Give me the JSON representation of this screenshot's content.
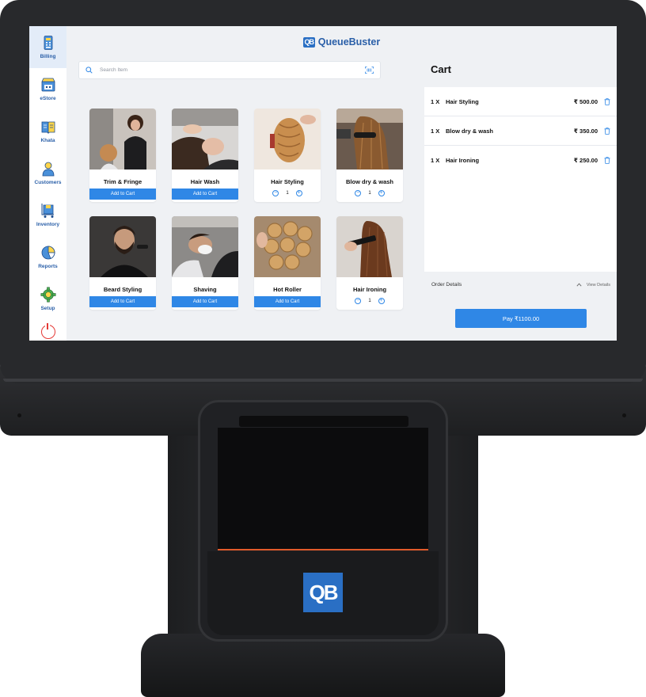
{
  "app": {
    "brand": "QueueBuster",
    "brand_mark": "QB",
    "device_logo": "QB"
  },
  "sidebar": {
    "items": [
      {
        "label": "Billing",
        "icon": "billing-icon",
        "active": true
      },
      {
        "label": "eStore",
        "icon": "estore-icon",
        "active": false
      },
      {
        "label": "Khata",
        "icon": "khata-icon",
        "active": false
      },
      {
        "label": "Customers",
        "icon": "customers-icon",
        "active": false
      },
      {
        "label": "Inventory",
        "icon": "inventory-icon",
        "active": false
      },
      {
        "label": "Reports",
        "icon": "reports-icon",
        "active": false
      },
      {
        "label": "Setup",
        "icon": "setup-icon",
        "active": false
      }
    ],
    "power_icon": "power-icon"
  },
  "search": {
    "placeholder": "Search Item"
  },
  "products": [
    {
      "name": "Trim & Fringe",
      "action": "Add to Cart",
      "in_cart": false
    },
    {
      "name": "Hair Wash",
      "action": "Add to Cart",
      "in_cart": false
    },
    {
      "name": "Hair Styling",
      "quantity": "1",
      "in_cart": true
    },
    {
      "name": "Blow dry & wash",
      "quantity": "1",
      "in_cart": true
    },
    {
      "name": "Beard Styling",
      "action": "Add to Cart",
      "in_cart": false
    },
    {
      "name": "Shaving",
      "action": "Add to Cart",
      "in_cart": false
    },
    {
      "name": "Hot Roller",
      "action": "Add to Cart",
      "in_cart": false
    },
    {
      "name": "Hair Ironing",
      "quantity": "1",
      "in_cart": true
    }
  ],
  "cart": {
    "title": "Cart",
    "items": [
      {
        "qty": "1 X",
        "name": "Hair Styling",
        "price": "₹ 500.00"
      },
      {
        "qty": "1 X",
        "name": "Blow dry & wash",
        "price": "₹ 350.00"
      },
      {
        "qty": "1 X",
        "name": "Hair Ironing",
        "price": "₹ 250.00"
      }
    ],
    "order_details_label": "Order Details",
    "view_details_label": "View Details",
    "pay_label": "Pay ₹1100.00"
  },
  "colors": {
    "accent": "#2f87e6",
    "brand": "#2a5fa8",
    "power": "#e53935"
  }
}
